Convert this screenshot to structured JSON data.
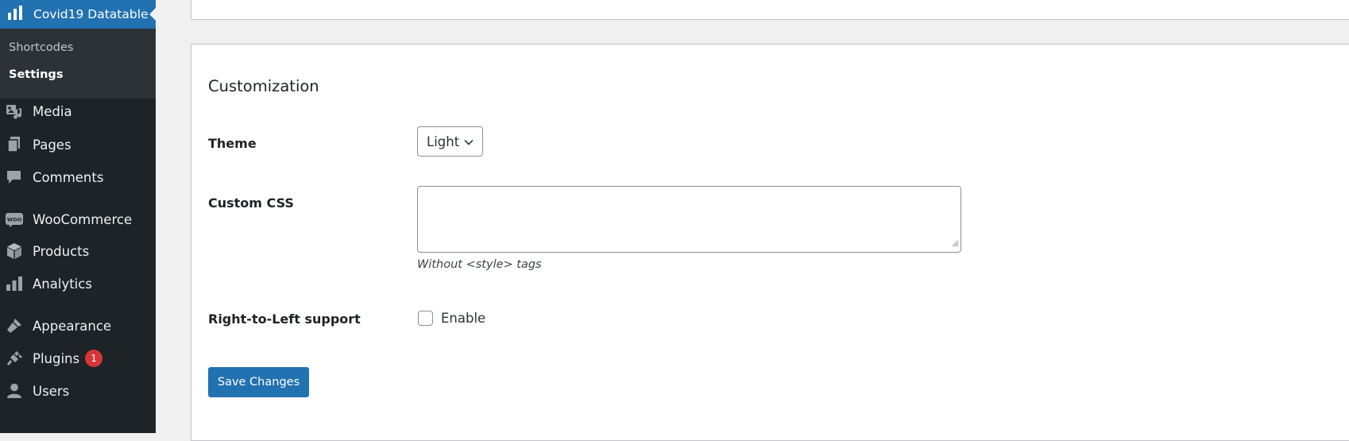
{
  "sidebar": {
    "active_plugin": {
      "label": "Covid19 Datatable",
      "icon": "bar-chart-icon"
    },
    "submenu": [
      {
        "label": "Shortcodes",
        "current": false
      },
      {
        "label": "Settings",
        "current": true
      }
    ],
    "items": [
      {
        "label": "Media",
        "icon": "media-icon"
      },
      {
        "label": "Pages",
        "icon": "pages-icon"
      },
      {
        "label": "Comments",
        "icon": "comments-icon"
      },
      {
        "label": "WooCommerce",
        "icon": "woo-icon",
        "icon_text": "WOO"
      },
      {
        "label": "Products",
        "icon": "box-icon"
      },
      {
        "label": "Analytics",
        "icon": "analytics-icon"
      },
      {
        "label": "Appearance",
        "icon": "brush-icon"
      },
      {
        "label": "Plugins",
        "icon": "plugin-icon",
        "badge": "1"
      },
      {
        "label": "Users",
        "icon": "user-icon"
      }
    ],
    "colors": {
      "background": "#1d2327",
      "active": "#2271b1",
      "submenu": "#2c3338",
      "badge": "#d63638"
    }
  },
  "main": {
    "section_title": "Customization",
    "theme": {
      "label": "Theme",
      "selected": "Light"
    },
    "custom_css": {
      "label": "Custom CSS",
      "value": "",
      "description": "Without <style> tags"
    },
    "rtl": {
      "label": "Right-to-Left support",
      "checkbox_label": "Enable",
      "checked": false
    },
    "save_button": "Save Changes"
  }
}
